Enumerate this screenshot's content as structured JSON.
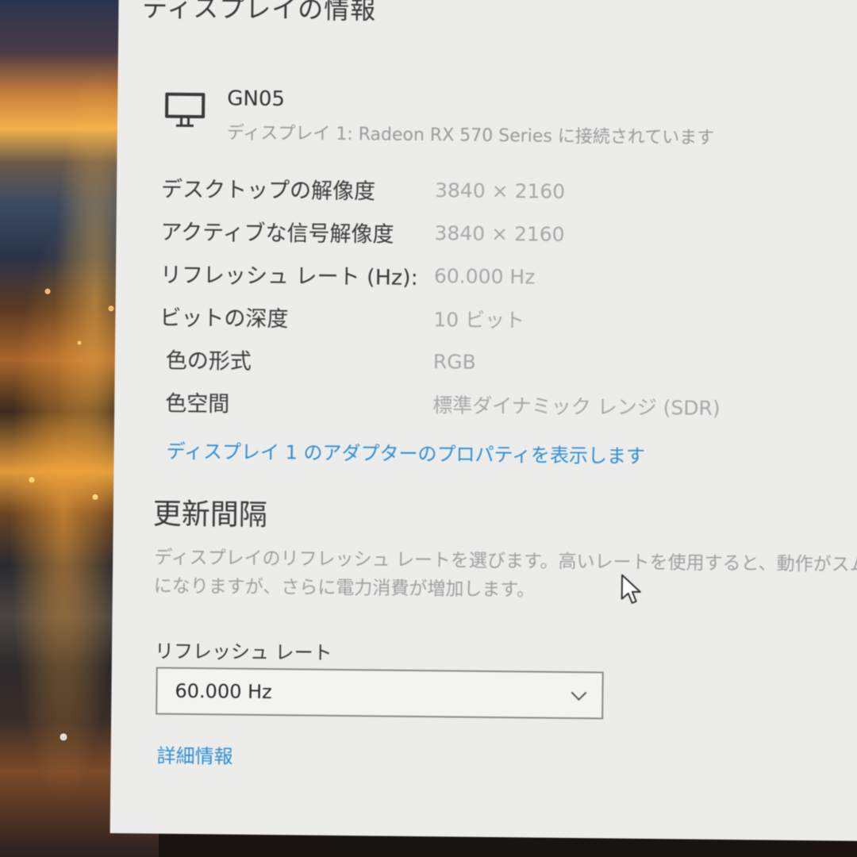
{
  "window": {
    "title": "ディスプレイの情報"
  },
  "monitor": {
    "icon": "monitor-icon",
    "name": "GN05",
    "connection": "ディスプレイ 1: Radeon RX 570 Series に接続されています"
  },
  "info": [
    {
      "label": "デスクトップの解像度",
      "value": "3840 × 2160"
    },
    {
      "label": "アクティブな信号解像度",
      "value": "3840 × 2160"
    },
    {
      "label": "リフレッシュ レート (Hz):",
      "value": "60.000 Hz"
    },
    {
      "label": "ビットの深度",
      "value": "10 ビット"
    },
    {
      "label": "色の形式",
      "value": "RGB"
    },
    {
      "label": "色空間",
      "value": "標準ダイナミック レンジ (SDR)"
    }
  ],
  "adapter_link": "ディスプレイ 1 のアダプターのプロパティを表示します",
  "refresh_section": {
    "title": "更新間隔",
    "description": "ディスプレイのリフレッシュ レートを選びます。高いレートを使用すると、動作がスムー",
    "description_line2": "になりますが、さらに電力消費が増加します。",
    "select_label": "リフレッシュ レート",
    "select_value": "60.000 Hz"
  },
  "details_link": "詳細情報",
  "colors": {
    "link": "#2f8fd6",
    "background": "#ecedeb"
  }
}
